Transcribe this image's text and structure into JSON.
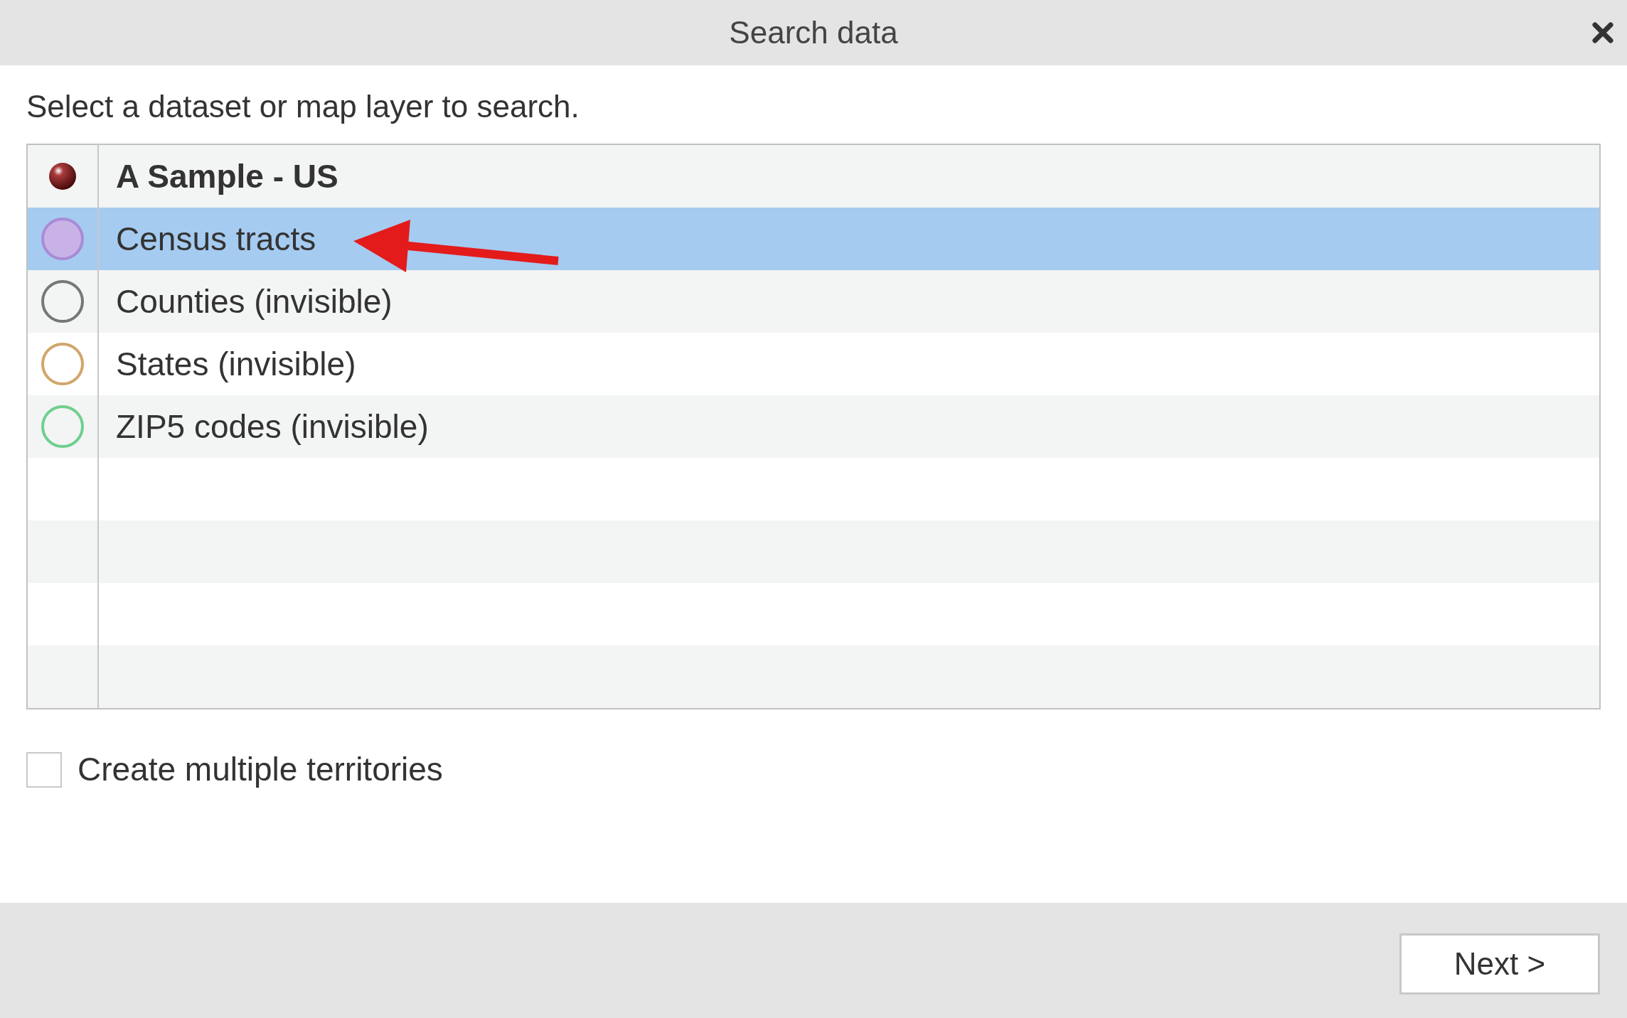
{
  "window": {
    "title": "Search data"
  },
  "instruction": "Select a dataset or map layer to search.",
  "items": [
    {
      "kind": "dataset",
      "label": "A Sample - US",
      "selected": false
    },
    {
      "kind": "layer",
      "label": "Census tracts",
      "selected": true,
      "color": "#a88bd6",
      "filled": true
    },
    {
      "kind": "layer",
      "label": "Counties (invisible)",
      "selected": false,
      "color": "#777777",
      "filled": false
    },
    {
      "kind": "layer",
      "label": "States (invisible)",
      "selected": false,
      "color": "#d2a66a",
      "filled": false
    },
    {
      "kind": "layer",
      "label": "ZIP5 codes (invisible)",
      "selected": false,
      "color": "#6fcf8f",
      "filled": false
    }
  ],
  "checkbox": {
    "label": "Create multiple territories",
    "checked": false
  },
  "buttons": [
    "Next >"
  ]
}
